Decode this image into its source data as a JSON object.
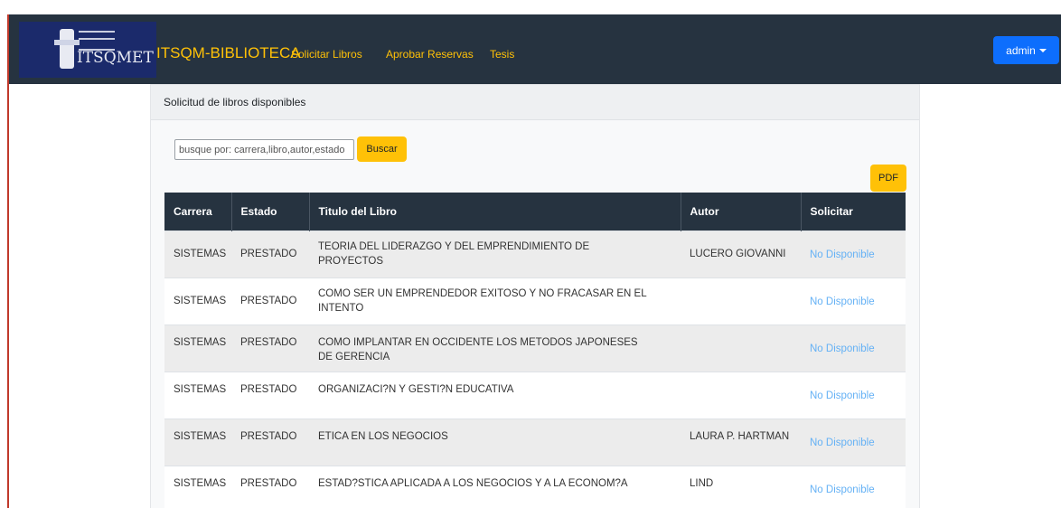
{
  "navbar": {
    "logo_text": "ITSQMET",
    "brand": "ITSQM-BIBLIOTECA",
    "links": [
      "Solicitar Libros",
      "Aprobar Reservas",
      "Tesis"
    ],
    "user_menu_label": "admin",
    "background_color": "#263340",
    "accent_color": "#ffc107"
  },
  "card": {
    "title": "Solicitud de libros disponibles"
  },
  "search": {
    "placeholder": "busque por: carrera,libro,autor,estado",
    "button_label": "Buscar"
  },
  "pdf_button_label": "PDF",
  "table": {
    "headers": [
      "Carrera",
      "Estado",
      "Titulo del Libro",
      "Autor",
      "Solicitar"
    ],
    "rows": [
      {
        "carrera": "SISTEMAS",
        "estado": "PRESTADO",
        "titulo": "TEORIA DEL LIDERAZGO Y DEL EMPRENDIMIENTO DE PROYECTOS",
        "autor": "LUCERO GIOVANNI",
        "solicitar": "No Disponible"
      },
      {
        "carrera": "SISTEMAS",
        "estado": "PRESTADO",
        "titulo": "COMO SER UN EMPRENDEDOR EXITOSO Y NO FRACASAR EN EL INTENTO",
        "autor": "",
        "solicitar": "No Disponible"
      },
      {
        "carrera": "SISTEMAS",
        "estado": "PRESTADO",
        "titulo": "COMO IMPLANTAR EN OCCIDENTE LOS METODOS JAPONESES DE GERENCIA",
        "autor": "",
        "solicitar": "No Disponible"
      },
      {
        "carrera": "SISTEMAS",
        "estado": "PRESTADO",
        "titulo": "ORGANIZACI?N Y GESTI?N EDUCATIVA",
        "autor": "",
        "solicitar": "No Disponible"
      },
      {
        "carrera": "SISTEMAS",
        "estado": "PRESTADO",
        "titulo": "ETICA EN LOS NEGOCIOS",
        "autor": "LAURA P. HARTMAN",
        "solicitar": "No Disponible"
      },
      {
        "carrera": "SISTEMAS",
        "estado": "PRESTADO",
        "titulo": "ESTAD?STICA APLICADA A LOS NEGOCIOS Y A LA ECONOM?A",
        "autor": "LIND",
        "solicitar": "No Disponible"
      }
    ]
  },
  "link_color": "#64b1f5"
}
